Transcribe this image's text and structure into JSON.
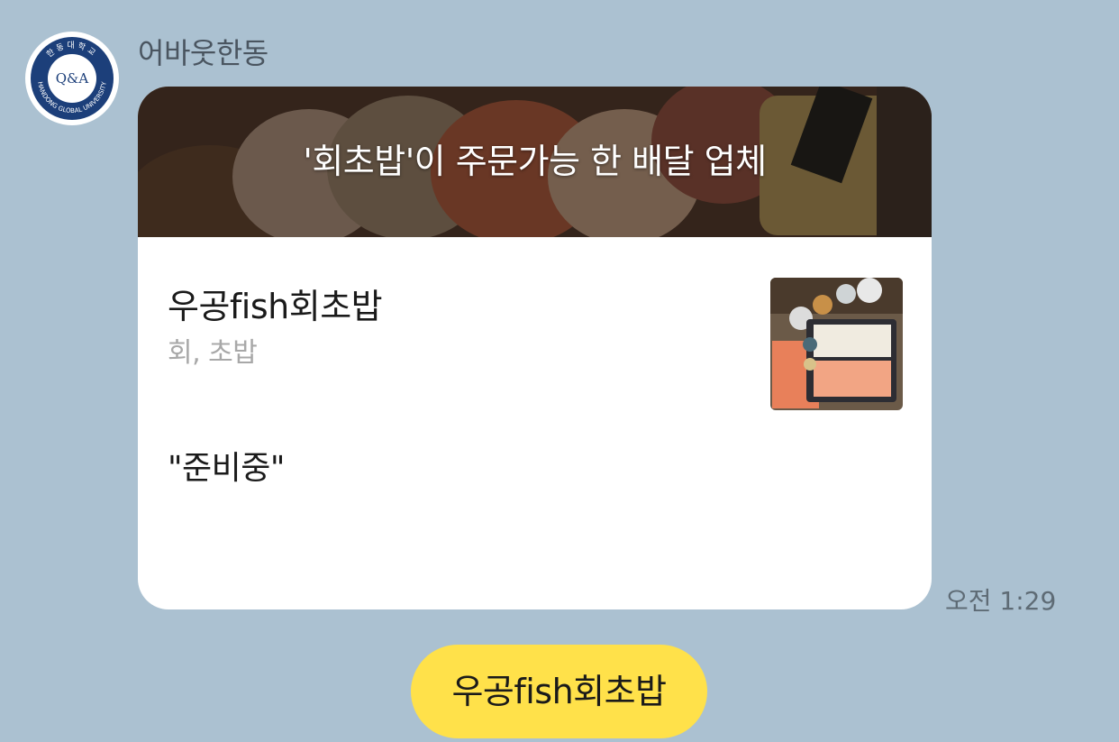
{
  "chat": {
    "sender_name": "어바웃한동",
    "timestamp": "오전 1:29"
  },
  "avatar": {
    "center_text": "Q&A",
    "ring_top_text": "한동대학교",
    "ring_bottom_text": "HANDONG GLOBAL UNIVERSITY",
    "ring_color": "#1c3f7a"
  },
  "card": {
    "header_title": "'회초밥'이 주문가능 한 배달 업체",
    "store_name": "우공fish회초밥",
    "store_category": "회, 초밥",
    "store_status": "\"준비중\""
  },
  "quick_reply": {
    "label": "우공fish회초밥",
    "color": "#ffe14a"
  },
  "colors": {
    "background": "#abc1d1",
    "card": "#ffffff"
  }
}
